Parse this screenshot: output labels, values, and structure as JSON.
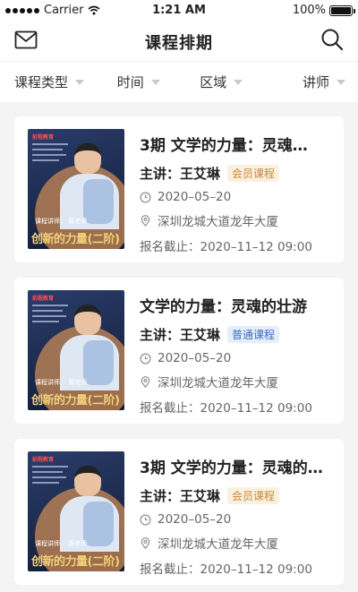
{
  "status_bar": {
    "carrier": "Carrier",
    "time": "1:21 AM",
    "battery": "100%"
  },
  "header": {
    "title": "课程排期",
    "left_icon": "mail-icon",
    "right_icon": "search-icon"
  },
  "filters": [
    {
      "label": "课程类型"
    },
    {
      "label": "时间"
    },
    {
      "label": "区域"
    },
    {
      "label": "讲师"
    }
  ],
  "thumbnail": {
    "logo_text": "前程教育",
    "caption": "课程讲师：  黄老师",
    "banner": "创新的力量(二阶)"
  },
  "courses": [
    {
      "title": "3期  文学的力量：灵魂…",
      "lecturer": "主讲：王艾琳",
      "badge": "会员课程",
      "badge_type": "member",
      "date": "2020–05–20",
      "location": "深圳龙城大道龙年大厦",
      "deadline": "报名截止：2020–11–12 09:00"
    },
    {
      "title": "文学的力量：灵魂的壮游",
      "lecturer": "主讲：王艾琳",
      "badge": "普通课程",
      "badge_type": "normal",
      "date": "2020–05–20",
      "location": "深圳龙城大道龙年大厦",
      "deadline": "报名截止：2020–11–12 09:00"
    },
    {
      "title": "3期  文学的力量：灵魂的…",
      "lecturer": "主讲：王艾琳",
      "badge": "会员课程",
      "badge_type": "member",
      "date": "2020–05–20",
      "location": "深圳龙城大道龙年大厦",
      "deadline": "报名截止：2020–11–12 09:00"
    }
  ]
}
